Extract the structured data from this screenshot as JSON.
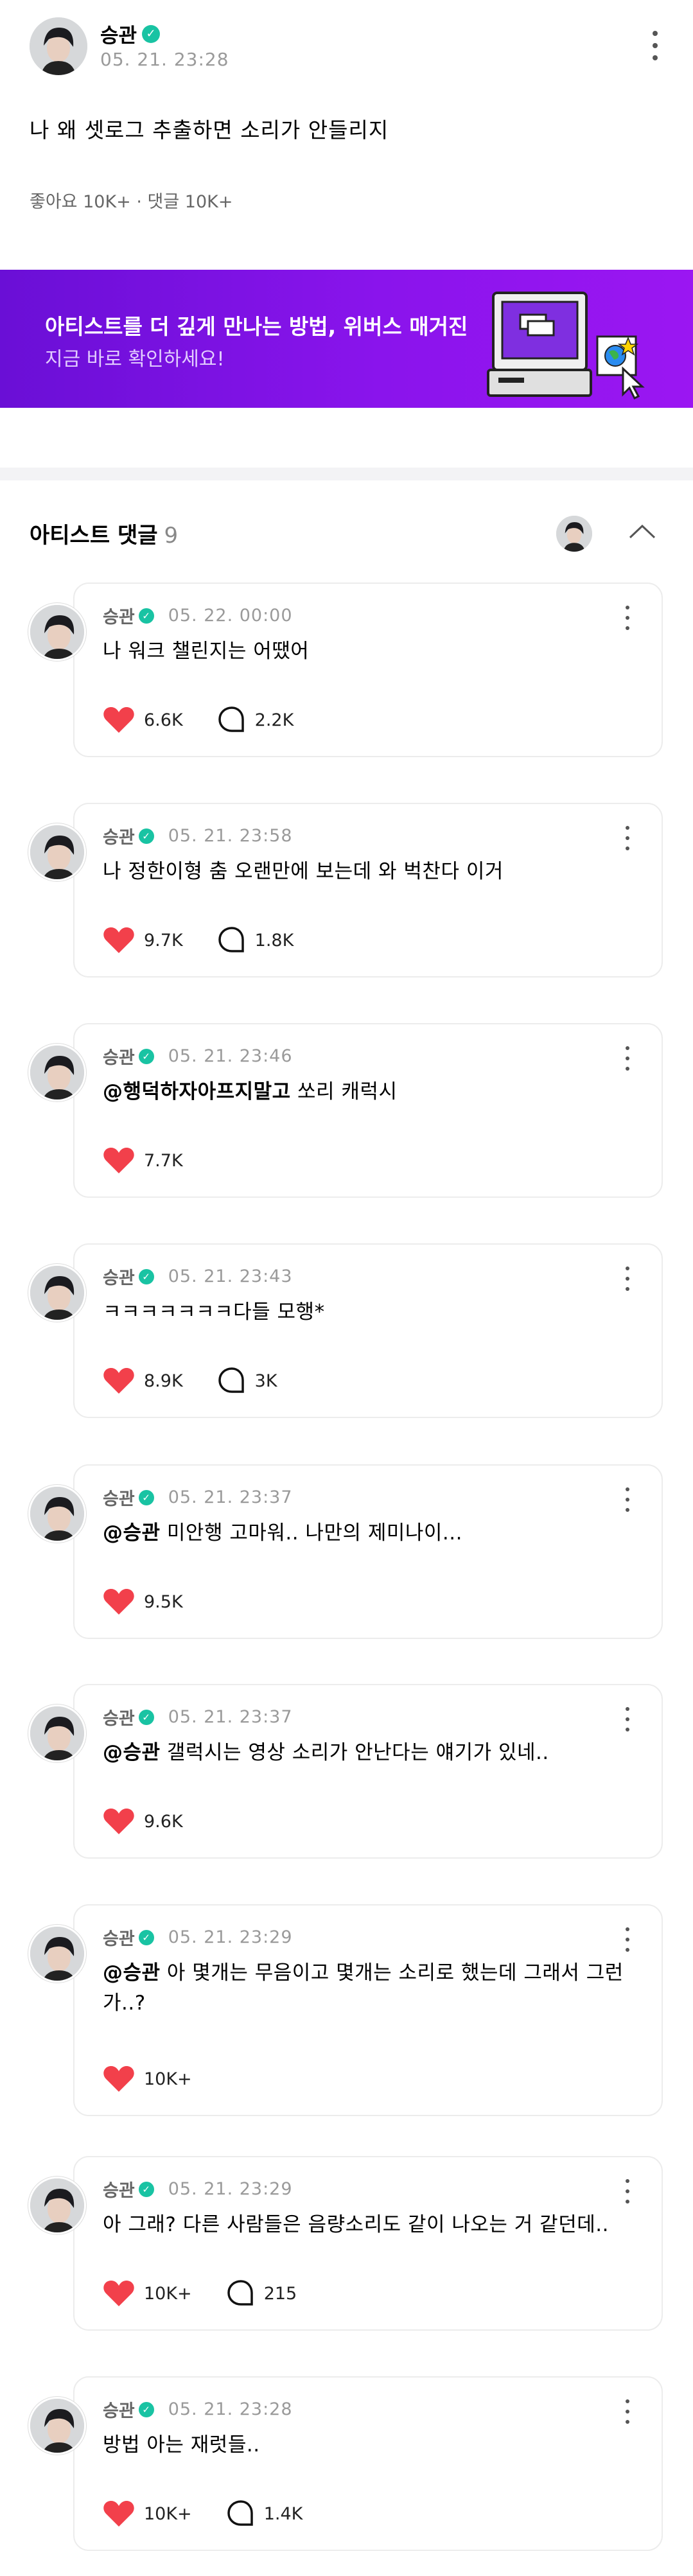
{
  "post": {
    "author": "승관",
    "time": "05. 21. 23:28",
    "body": "나 왜 셋로그 추출하면 소리가 안들리지",
    "stats": "좋아요 10K+ · 댓글 10K+"
  },
  "banner": {
    "title": "아티스트를 더 깊게 만나는 방법, 위버스 매거진",
    "subtitle": "지금 바로 확인하세요!"
  },
  "artist_comments": {
    "label": "아티스트 댓글",
    "count": "9"
  },
  "colors": {
    "accent_verified": "#19c3a3",
    "like_red": "#f2404b",
    "banner_purple": "#7c12e6"
  },
  "comments": [
    {
      "name": "승관",
      "time": "05. 22. 00:00",
      "mention": "",
      "text": "나 워크 챌린지는 어땠어",
      "likes": "6.6K",
      "replies": "2.2K"
    },
    {
      "name": "승관",
      "time": "05. 21. 23:58",
      "mention": "",
      "text": "나 정한이형 춤 오랜만에 보는데 와 벅찬다 이거",
      "likes": "9.7K",
      "replies": "1.8K"
    },
    {
      "name": "승관",
      "time": "05. 21. 23:46",
      "mention": "@행덕하자아프지말고",
      "text": " 쏘리 캐럭시",
      "likes": "7.7K",
      "replies": ""
    },
    {
      "name": "승관",
      "time": "05. 21. 23:43",
      "mention": "",
      "text": "ㅋㅋㅋㅋㅋㅋㅋ다들 모행*",
      "likes": "8.9K",
      "replies": "3K"
    },
    {
      "name": "승관",
      "time": "05. 21. 23:37",
      "mention": "@승관",
      "text": " 미안행 고마워.. 나만의 제미나이...",
      "likes": "9.5K",
      "replies": ""
    },
    {
      "name": "승관",
      "time": "05. 21. 23:37",
      "mention": "@승관",
      "text": " 갤럭시는 영상 소리가 안난다는 얘기가 있네..",
      "likes": "9.6K",
      "replies": ""
    },
    {
      "name": "승관",
      "time": "05. 21. 23:29",
      "mention": "@승관",
      "text": " 아 몇개는 무음이고 몇개는 소리로 했는데 그래서 그런가..?",
      "likes": "10K+",
      "replies": ""
    },
    {
      "name": "승관",
      "time": "05. 21. 23:29",
      "mention": "",
      "text": "아 그래? 다른 사람들은 음량소리도 같이 나오는 거 같던데..",
      "likes": "10K+",
      "replies": "215"
    },
    {
      "name": "승관",
      "time": "05. 21. 23:28",
      "mention": "",
      "text": "방법 아는 재럿들..",
      "likes": "10K+",
      "replies": "1.4K"
    }
  ]
}
